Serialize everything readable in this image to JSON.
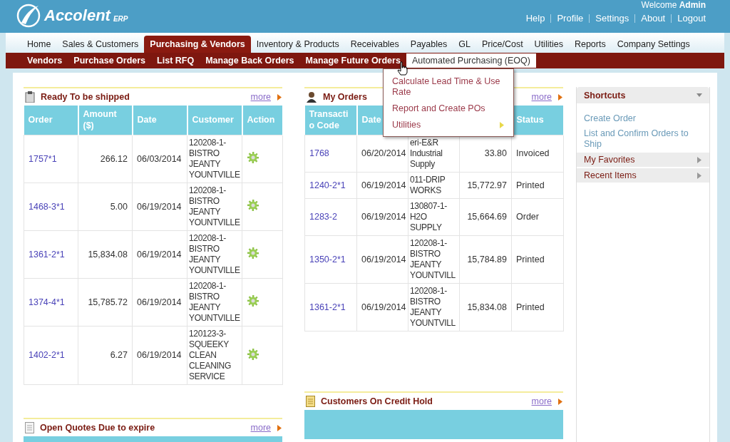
{
  "header": {
    "logo_text": "Accolent",
    "logo_suffix": "ERP",
    "welcome": "Welcome",
    "user": "Admin",
    "links": [
      "Help",
      "Profile",
      "Settings",
      "About",
      "Logout"
    ]
  },
  "nav": [
    {
      "label": "Home",
      "selected": false
    },
    {
      "label": "Sales & Customers",
      "selected": false
    },
    {
      "label": "Purchasing & Vendors",
      "selected": true
    },
    {
      "label": "Inventory & Products",
      "selected": false
    },
    {
      "label": "Receivables",
      "selected": false
    },
    {
      "label": "Payables",
      "selected": false
    },
    {
      "label": "GL",
      "selected": false
    },
    {
      "label": "Price/Cost",
      "selected": false
    },
    {
      "label": "Utilities",
      "selected": false
    },
    {
      "label": "Reports",
      "selected": false
    },
    {
      "label": "Company Settings",
      "selected": false
    }
  ],
  "subnav": [
    {
      "label": "Vendors",
      "selected": false
    },
    {
      "label": "Purchase Orders",
      "selected": false
    },
    {
      "label": "List RFQ",
      "selected": false
    },
    {
      "label": "Manage Back Orders",
      "selected": false
    },
    {
      "label": "Manage Future Orders",
      "selected": false
    },
    {
      "label": "Automated Purchasing (EOQ)",
      "selected": true
    }
  ],
  "dropdown": [
    {
      "label": "Calculate Lead Time & Use Rate",
      "submenu": false
    },
    {
      "label": "Report and Create POs",
      "submenu": false
    },
    {
      "label": "Utilities",
      "submenu": true
    }
  ],
  "ready_to_ship": {
    "title": "Ready To be shipped",
    "more": "more",
    "columns": [
      "Order",
      "Amount ($)",
      "Date",
      "Customer",
      "Action"
    ],
    "rows": [
      {
        "order": "1757*1",
        "amount": "266.12",
        "date": "06/03/2014",
        "customer": "120208-1-BISTRO JEANTY YOUNTVILLE"
      },
      {
        "order": "1468-3*1",
        "amount": "5.00",
        "date": "06/19/2014",
        "customer": "120208-1-BISTRO JEANTY YOUNTVILLE"
      },
      {
        "order": "1361-2*1",
        "amount": "15,834.08",
        "date": "06/19/2014",
        "customer": "120208-1-BISTRO JEANTY YOUNTVILLE"
      },
      {
        "order": "1374-4*1",
        "amount": "15,785.72",
        "date": "06/19/2014",
        "customer": "120208-1-BISTRO JEANTY YOUNTVILLE"
      },
      {
        "order": "1402-2*1",
        "amount": "6.27",
        "date": "06/19/2014",
        "customer": "120123-3-SQUEEKY CLEAN CLEANING SERVICE"
      }
    ]
  },
  "my_orders": {
    "title": "My Orders",
    "more": "more",
    "columns": [
      {
        "label": "Transactio Code"
      },
      {
        "label": "Date"
      },
      {},
      {},
      {
        "label": "Status"
      }
    ],
    "rows": [
      {
        "code": "1768",
        "date": "06/20/2014",
        "customer": "eri-E&R Industrial Supply",
        "amount": "33.80",
        "status": "Invoiced"
      },
      {
        "code": "1240-2*1",
        "date": "06/19/2014",
        "customer": "011-DRIP WORKS",
        "amount": "15,772.97",
        "status": "Printed"
      },
      {
        "code": "1283-2",
        "date": "06/19/2014",
        "customer": "130807-1-H2O SUPPLY",
        "amount": "15,664.69",
        "status": "Order"
      },
      {
        "code": "1350-2*1",
        "date": "06/19/2014",
        "customer": "120208-1-BISTRO JEANTY YOUNTVILL",
        "amount": "15,784.89",
        "status": "Printed"
      },
      {
        "code": "1361-2*1",
        "date": "06/19/2014",
        "customer": "120208-1-BISTRO JEANTY YOUNTVILL",
        "amount": "15,834.08",
        "status": "Printed"
      }
    ]
  },
  "open_quotes": {
    "title": "Open Quotes Due to expire",
    "more": "more"
  },
  "credit_hold": {
    "title": "Customers On Credit Hold",
    "more": "more"
  },
  "shortcuts": {
    "title": "Shortcuts",
    "links": [
      "Create Order",
      "List and Confirm Orders to Ship"
    ],
    "sections": [
      "My Favorites",
      "Recent Items"
    ]
  }
}
